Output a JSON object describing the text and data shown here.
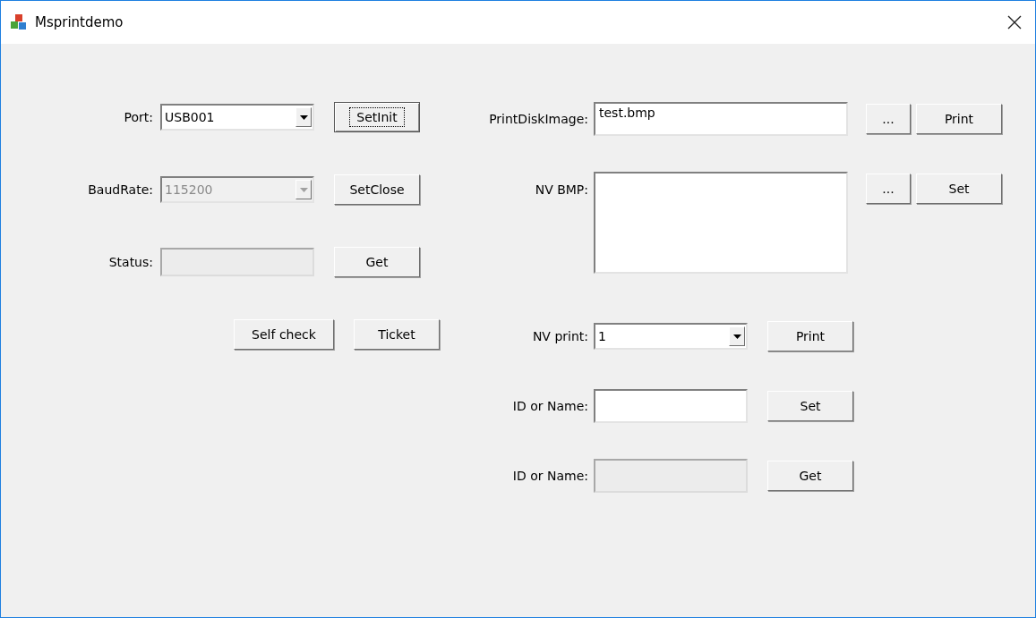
{
  "window": {
    "title": "Msprintdemo"
  },
  "left": [
    {
      "kind": "combo",
      "label": "Port:",
      "value": "USB001",
      "disabled": false,
      "buttons": [
        {
          "label": "SetInit",
          "focused": true
        }
      ]
    },
    {
      "kind": "combo",
      "label": "BaudRate:",
      "value": "115200",
      "disabled": true,
      "buttons": [
        {
          "label": "SetClose",
          "focused": false
        }
      ]
    },
    {
      "kind": "text",
      "label": "Status:",
      "disabled": true,
      "buttons": [
        {
          "label": "Get",
          "focused": false
        }
      ]
    },
    {
      "kind": "buttons",
      "buttons": [
        {
          "label": "Self check",
          "focused": false
        },
        {
          "label": "Ticket",
          "focused": false
        }
      ]
    }
  ],
  "right": [
    {
      "kind": "text",
      "label": "PrintDiskImage:",
      "value": "test.bmp",
      "disabled": false,
      "buttons": [
        {
          "label": "...",
          "focused": false
        },
        {
          "label": "Print",
          "focused": false
        }
      ]
    },
    {
      "kind": "multiline",
      "label": "NV BMP:",
      "disabled": false,
      "buttons": [
        {
          "label": "...",
          "focused": false
        },
        {
          "label": "Set",
          "focused": false
        }
      ]
    },
    {
      "kind": "combo",
      "label": "NV print:",
      "value": "1",
      "disabled": false,
      "buttons": [
        {
          "label": "Print",
          "focused": false
        }
      ]
    },
    {
      "kind": "text",
      "label": "ID or Name:",
      "disabled": false,
      "buttons": [
        {
          "label": "Set",
          "focused": false
        }
      ]
    },
    {
      "kind": "text",
      "label": "ID or Name:",
      "disabled": true,
      "buttons": [
        {
          "label": "Get",
          "focused": false
        }
      ]
    }
  ]
}
